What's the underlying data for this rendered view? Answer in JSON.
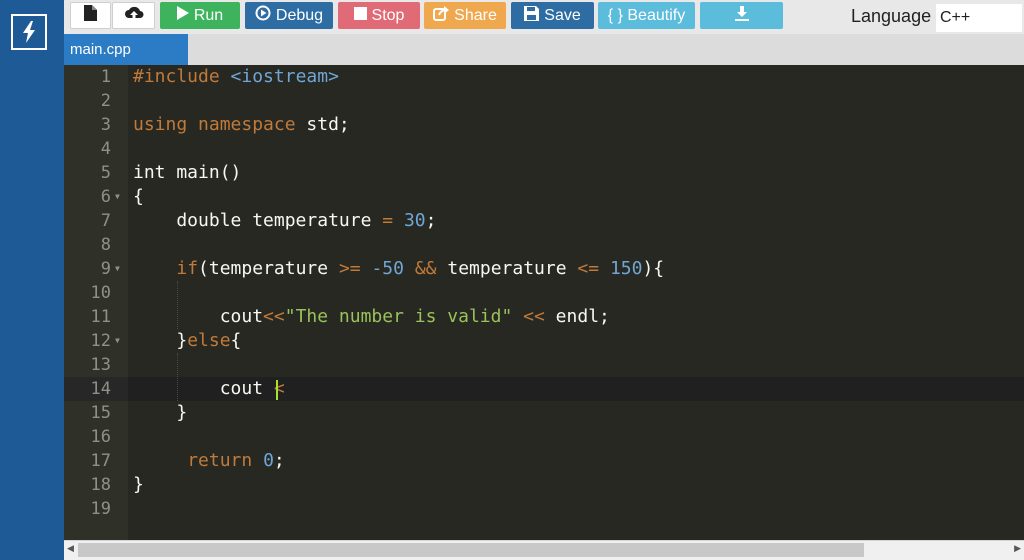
{
  "toolbar": {
    "run_label": "Run",
    "debug_label": "Debug",
    "stop_label": "Stop",
    "share_label": "Share",
    "save_label": "Save",
    "beautify_label": "{ } Beautify",
    "language_label": "Language",
    "language_value": "C++",
    "colors": {
      "run": "#3db35d",
      "debug": "#2e6da4",
      "stop": "#e06b76",
      "share": "#f0a84f",
      "save": "#2e6da4",
      "beautify": "#5bbcdc",
      "download": "#5bbcdc"
    }
  },
  "tab": {
    "label": "main.cpp"
  },
  "editor": {
    "line_numbers": [
      "1",
      "2",
      "3",
      "4",
      "5",
      "6",
      "7",
      "8",
      "9",
      "10",
      "11",
      "12",
      "13",
      "14",
      "15",
      "16",
      "17",
      "18",
      "19"
    ],
    "lines": [
      "#include <iostream>",
      "",
      "using namespace std;",
      "",
      "int main()",
      "{",
      "    double temperature = 30;",
      "",
      "    if(temperature >= -50 && temperature <= 150){",
      "",
      "        cout<<\"The number is valid\" << endl;",
      "    }else{",
      "",
      "        cout <",
      "    }",
      "",
      "     return 0;",
      "}",
      ""
    ],
    "active_line": 14
  },
  "icons": [
    "lightning-logo-icon",
    "new-file-icon",
    "upload-cloud-icon",
    "play-icon",
    "debug-icon",
    "stop-icon",
    "share-icon",
    "save-floppy-icon",
    "download-icon"
  ]
}
